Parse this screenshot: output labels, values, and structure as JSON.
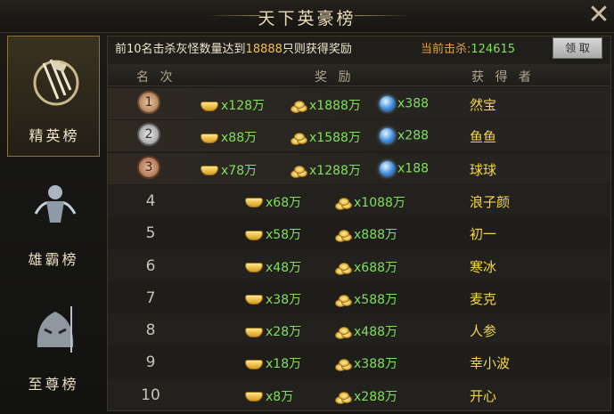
{
  "window": {
    "title": "天下英豪榜",
    "close_icon": "close-x-icon"
  },
  "tabs": [
    {
      "label": "精英榜",
      "icon": "banner-flags-icon",
      "active": true
    },
    {
      "label": "雄霸榜",
      "icon": "warrior-emblem-icon",
      "active": false
    },
    {
      "label": "至尊榜",
      "icon": "demon-king-emblem-icon",
      "active": false
    }
  ],
  "notice": {
    "prefix": "前10名击杀灰怪数量达到",
    "target": "18888",
    "suffix": "只则获得奖励"
  },
  "kills": {
    "label": "当前击杀:",
    "value": "124615"
  },
  "claim_label": "领 取",
  "headers": {
    "rank": "名 次",
    "reward": "奖 励",
    "winner": "获 得 者"
  },
  "rows": [
    {
      "rank": "1",
      "medal": "gold",
      "ingot": "x128万",
      "coins": "x1888万",
      "orb": "x388",
      "name": "然宝"
    },
    {
      "rank": "2",
      "medal": "silver",
      "ingot": "x88万",
      "coins": "x1588万",
      "orb": "x288",
      "name": "鱼鱼"
    },
    {
      "rank": "3",
      "medal": "bronze",
      "ingot": "x78万",
      "coins": "x1288万",
      "orb": "x188",
      "name": "球球"
    },
    {
      "rank": "4",
      "ingot": "x68万",
      "coins": "x1088万",
      "name": "浪子颜"
    },
    {
      "rank": "5",
      "ingot": "x58万",
      "coins": "x888万",
      "name": "初一"
    },
    {
      "rank": "6",
      "ingot": "x48万",
      "coins": "x688万",
      "name": "寒冰"
    },
    {
      "rank": "7",
      "ingot": "x38万",
      "coins": "x588万",
      "name": "麦克"
    },
    {
      "rank": "8",
      "ingot": "x28万",
      "coins": "x488万",
      "name": "人参"
    },
    {
      "rank": "9",
      "ingot": "x18万",
      "coins": "x388万",
      "name": "幸小波"
    },
    {
      "rank": "10",
      "ingot": "x8万",
      "coins": "x288万",
      "name": "开心"
    }
  ],
  "colors": {
    "reward_text": "#7fe05c",
    "name_text": "#f4d646",
    "notice_highlight": "#f2c24d",
    "kills_label": "#e0a14a"
  }
}
